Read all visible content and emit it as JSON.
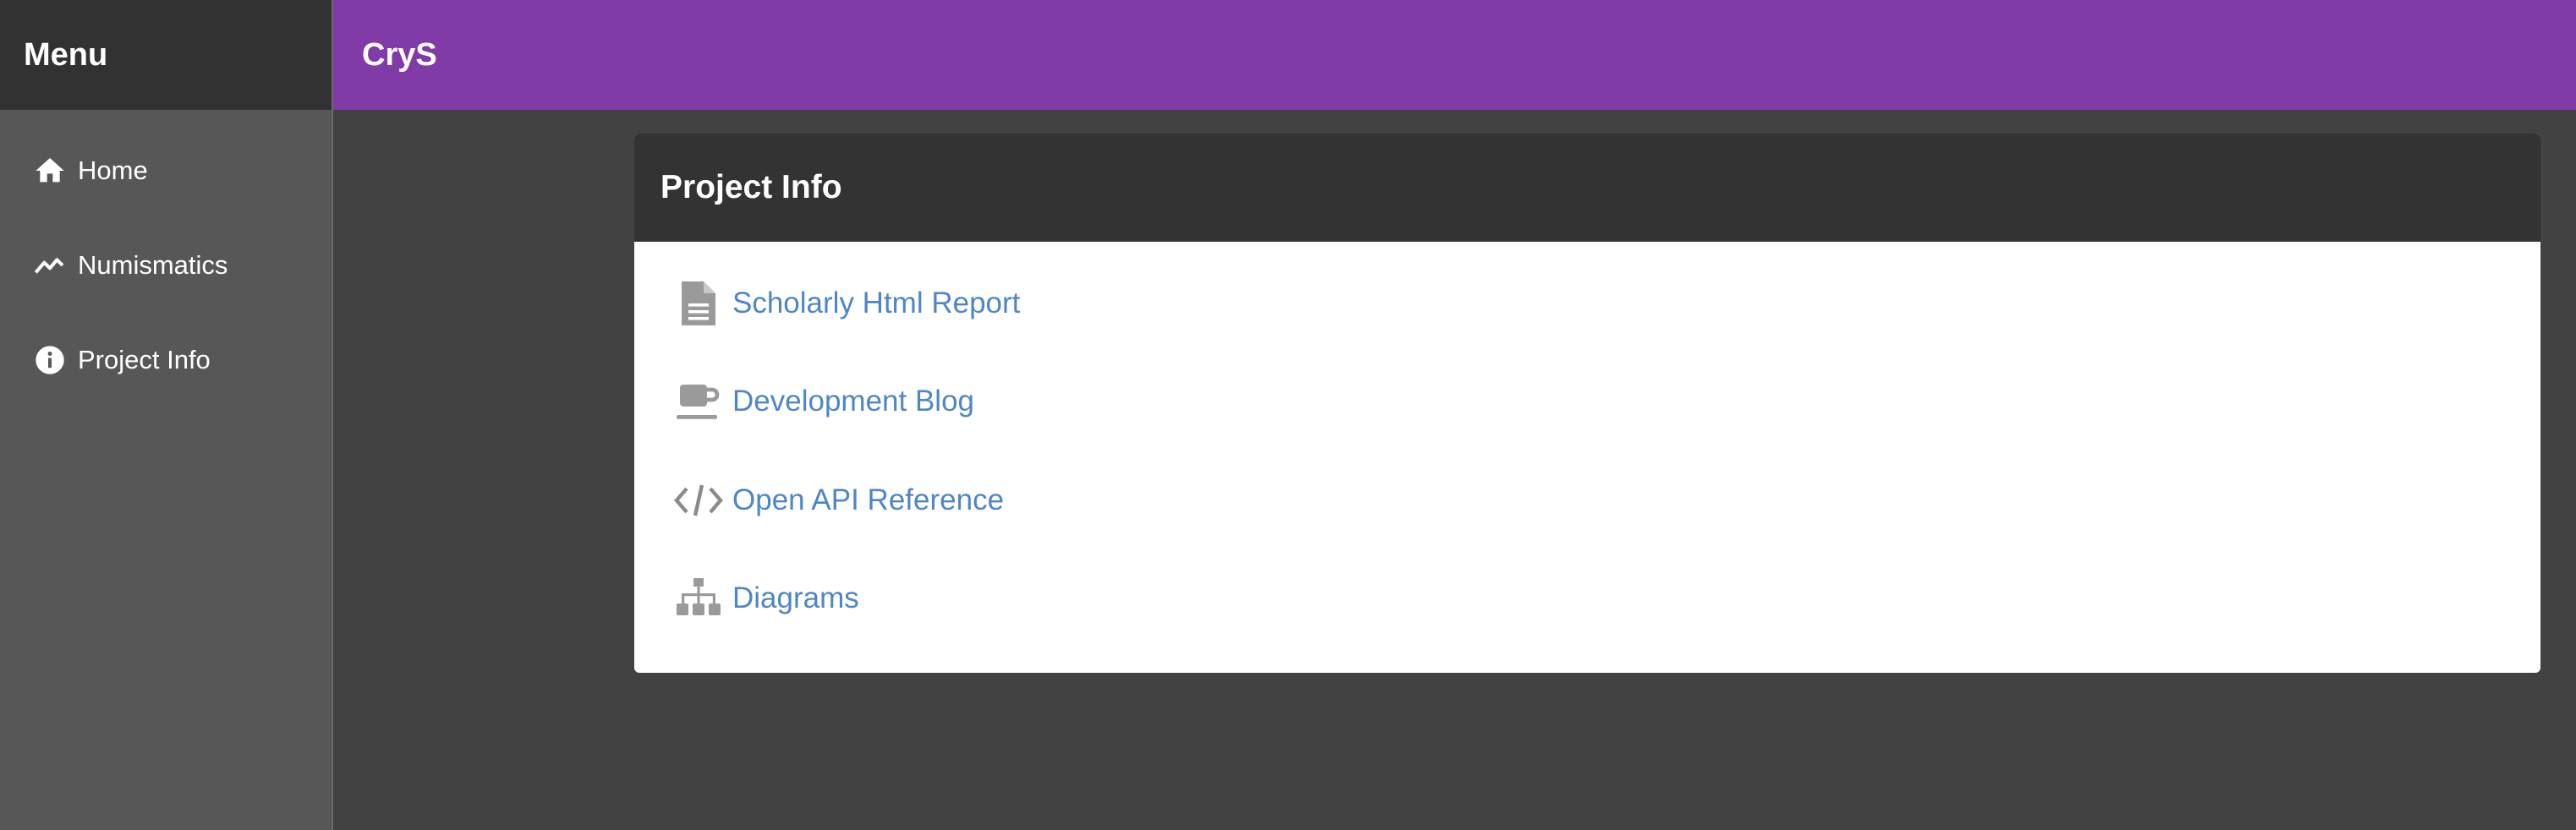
{
  "sidebar": {
    "title": "Menu",
    "items": [
      {
        "label": "Home",
        "icon": "home-icon"
      },
      {
        "label": "Numismatics",
        "icon": "trending-up-icon"
      },
      {
        "label": "Project Info",
        "icon": "info-icon"
      }
    ]
  },
  "header": {
    "app_title": "CryS",
    "accent_color": "#813ba6"
  },
  "main": {
    "card_title": "Project Info",
    "links": [
      {
        "label": "Scholarly Html Report",
        "icon": "document-icon"
      },
      {
        "label": "Development Blog",
        "icon": "coffee-cup-icon"
      },
      {
        "label": "Open API Reference",
        "icon": "code-icon"
      },
      {
        "label": "Diagrams",
        "icon": "sitemap-icon"
      }
    ],
    "link_color": "#4f86c6"
  }
}
